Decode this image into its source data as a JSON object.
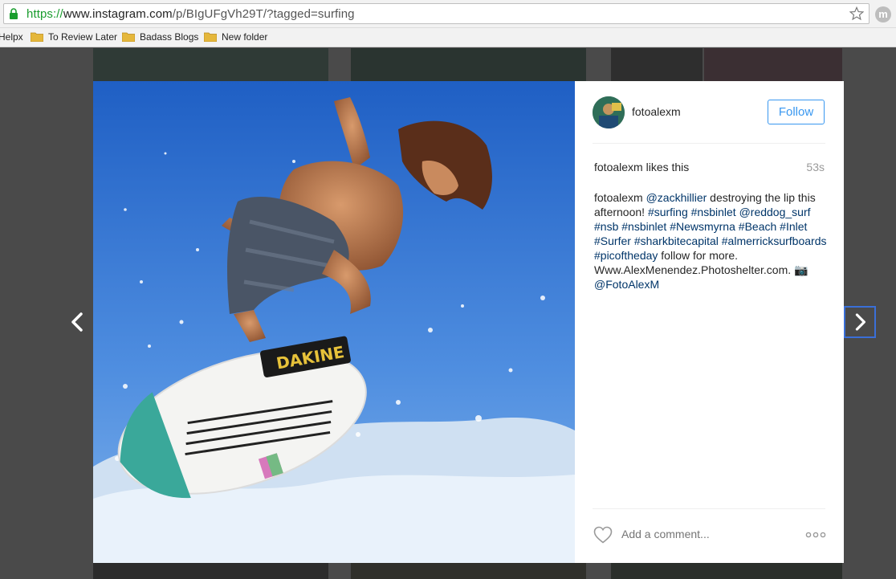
{
  "browser": {
    "url_scheme": "https://",
    "url_host": "www.instagram.com",
    "url_path": "/p/BIgUFgVh29T/?tagged=surfing",
    "profile_initial": "m",
    "bookmarks": [
      {
        "label": "Helpx",
        "folder": false
      },
      {
        "label": "To Review Later",
        "folder": true
      },
      {
        "label": "Badass Blogs",
        "folder": true
      },
      {
        "label": "New folder",
        "folder": true
      }
    ]
  },
  "post": {
    "username": "fotoalexm",
    "follow_label": "Follow",
    "likes_user": "fotoalexm",
    "likes_text": " likes this",
    "time_ago": "53s",
    "caption_user": "fotoalexm",
    "caption_parts": [
      {
        "text": "@zackhillier",
        "tag": true
      },
      {
        "text": " destroying the lip this afternoon! ",
        "tag": false
      },
      {
        "text": "#surfing",
        "tag": true
      },
      {
        "text": " ",
        "tag": false
      },
      {
        "text": "#nsbinlet",
        "tag": true
      },
      {
        "text": " ",
        "tag": false
      },
      {
        "text": "@reddog_surf",
        "tag": true
      },
      {
        "text": " ",
        "tag": false
      },
      {
        "text": "#nsb",
        "tag": true
      },
      {
        "text": " ",
        "tag": false
      },
      {
        "text": "#nsbinlet",
        "tag": true
      },
      {
        "text": " ",
        "tag": false
      },
      {
        "text": "#Newsmyrna",
        "tag": true
      },
      {
        "text": " ",
        "tag": false
      },
      {
        "text": "#Beach",
        "tag": true
      },
      {
        "text": " ",
        "tag": false
      },
      {
        "text": "#Inlet",
        "tag": true
      },
      {
        "text": " ",
        "tag": false
      },
      {
        "text": "#Surfer",
        "tag": true
      },
      {
        "text": " ",
        "tag": false
      },
      {
        "text": "#sharkbitecapital",
        "tag": true
      },
      {
        "text": " ",
        "tag": false
      },
      {
        "text": "#almerricksurfboards",
        "tag": true
      },
      {
        "text": " ",
        "tag": false
      },
      {
        "text": "#picoftheday",
        "tag": true
      },
      {
        "text": " follow for more. Www.AlexMenendez.Photoshelter.com. 📷 ",
        "tag": false
      },
      {
        "text": "@FotoAlexM",
        "tag": true
      }
    ],
    "comment_placeholder": "Add a comment...",
    "board_brand": "DAKINE"
  },
  "colors": {
    "accent": "#3897f0",
    "hashtag": "#003569",
    "overlay": "#4a4a4a",
    "sky": "#3f7fd9"
  },
  "icons": [
    "lock-icon",
    "star-icon",
    "folder-icon",
    "heart-icon",
    "more-icon",
    "chevron-left-icon",
    "chevron-right-icon"
  ]
}
